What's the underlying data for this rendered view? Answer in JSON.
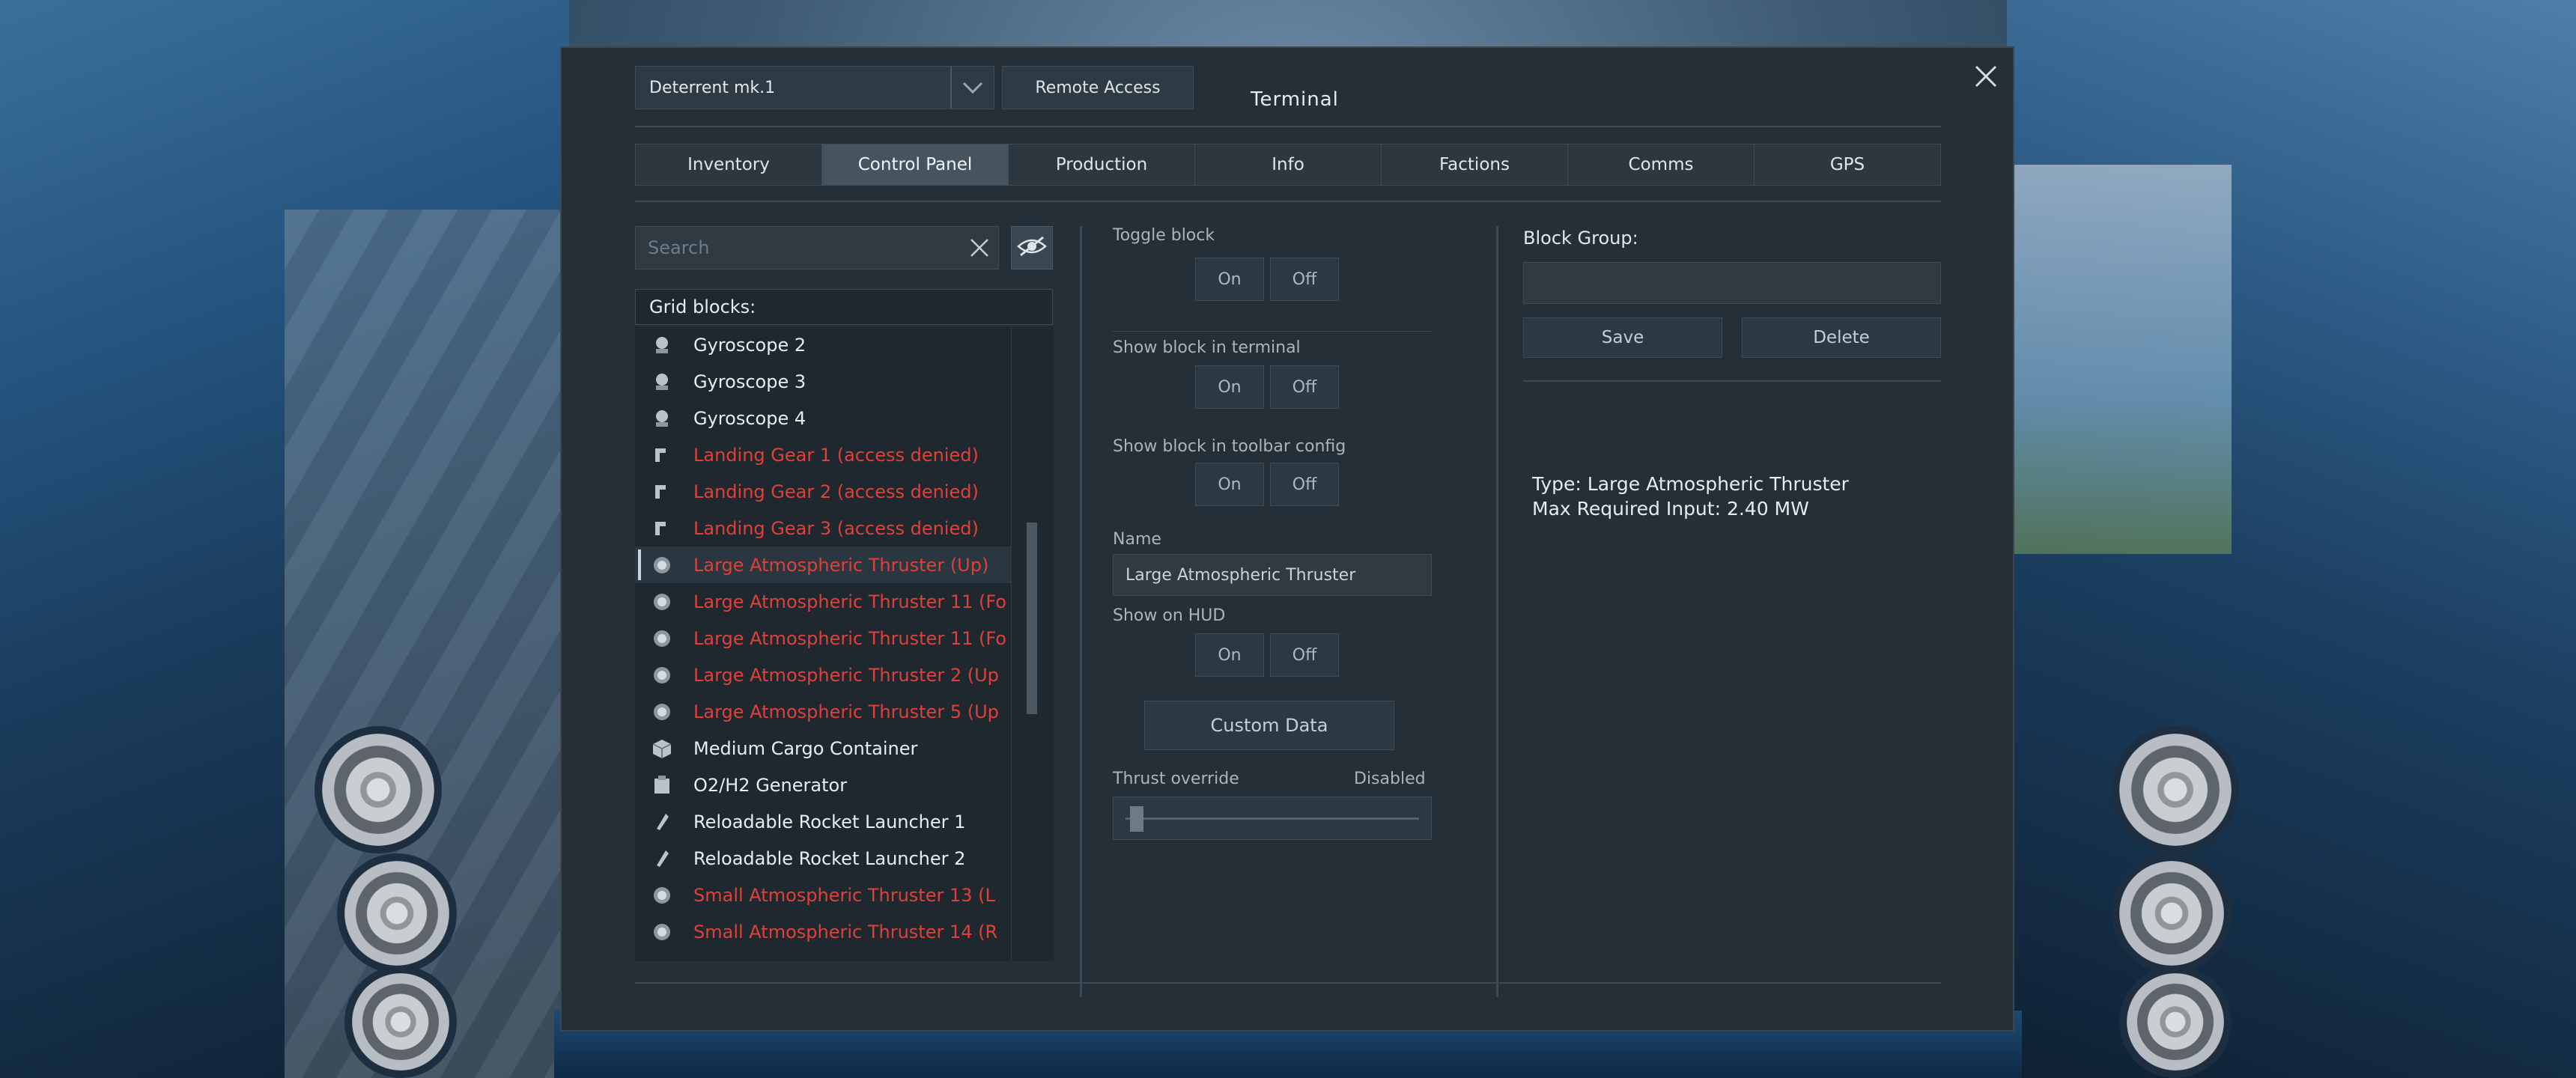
{
  "header": {
    "ship_name": "Deterrent mk.1",
    "remote_access_label": "Remote Access",
    "title": "Terminal"
  },
  "tabs": [
    {
      "label": "Inventory",
      "active": false
    },
    {
      "label": "Control Panel",
      "active": true
    },
    {
      "label": "Production",
      "active": false
    },
    {
      "label": "Info",
      "active": false
    },
    {
      "label": "Factions",
      "active": false
    },
    {
      "label": "Comms",
      "active": false
    },
    {
      "label": "GPS",
      "active": false
    }
  ],
  "search": {
    "placeholder": "Search",
    "value": ""
  },
  "grid_blocks_header": "Grid blocks:",
  "blocks": [
    {
      "label": "Gyroscope 2",
      "icon": "gyroscope-icon",
      "denied": false
    },
    {
      "label": "Gyroscope 3",
      "icon": "gyroscope-icon",
      "denied": false
    },
    {
      "label": "Gyroscope 4",
      "icon": "gyroscope-icon",
      "denied": false
    },
    {
      "label": "Landing Gear 1 (access denied)",
      "icon": "landing-gear-icon",
      "denied": true
    },
    {
      "label": "Landing Gear 2 (access denied)",
      "icon": "landing-gear-icon",
      "denied": true
    },
    {
      "label": "Landing Gear 3 (access denied)",
      "icon": "landing-gear-icon",
      "denied": true
    },
    {
      "label": "Large Atmospheric Thruster (Up)",
      "icon": "thruster-icon",
      "denied": true,
      "selected": true
    },
    {
      "label": "Large Atmospheric Thruster 11 (Fo",
      "icon": "thruster-icon",
      "denied": true
    },
    {
      "label": "Large Atmospheric Thruster 11 (Fo",
      "icon": "thruster-icon",
      "denied": true
    },
    {
      "label": "Large Atmospheric Thruster 2 (Up",
      "icon": "thruster-icon",
      "denied": true
    },
    {
      "label": "Large Atmospheric Thruster 5 (Up",
      "icon": "thruster-icon",
      "denied": true
    },
    {
      "label": "Medium Cargo Container",
      "icon": "cargo-container-icon",
      "denied": false
    },
    {
      "label": "O2/H2 Generator",
      "icon": "generator-icon",
      "denied": false
    },
    {
      "label": "Reloadable Rocket Launcher 1",
      "icon": "rocket-launcher-icon",
      "denied": false
    },
    {
      "label": "Reloadable Rocket Launcher 2",
      "icon": "rocket-launcher-icon",
      "denied": false
    },
    {
      "label": "Small Atmospheric Thruster 13 (L",
      "icon": "thruster-icon",
      "denied": true
    },
    {
      "label": "Small Atmospheric Thruster 14 (R",
      "icon": "thruster-icon",
      "denied": true
    }
  ],
  "controls": {
    "toggle_block_label": "Toggle block",
    "show_terminal_label": "Show block in terminal",
    "show_toolbar_label": "Show block in toolbar config",
    "name_label": "Name",
    "name_value": "Large Atmospheric Thruster",
    "show_hud_label": "Show on HUD",
    "on_label": "On",
    "off_label": "Off",
    "custom_data_label": "Custom Data",
    "thrust_override_label": "Thrust override",
    "thrust_override_value": "Disabled",
    "thrust_override_level": 0
  },
  "block_group": {
    "label": "Block Group:",
    "value": "",
    "save_label": "Save",
    "delete_label": "Delete"
  },
  "info": {
    "type_line": "Type: Large Atmospheric Thruster",
    "power_line": "Max Required Input: 2.40 MW"
  },
  "colors": {
    "denied_text": "#e0403a",
    "panel_bg": "#252f37",
    "active_tab": "#46545f"
  }
}
